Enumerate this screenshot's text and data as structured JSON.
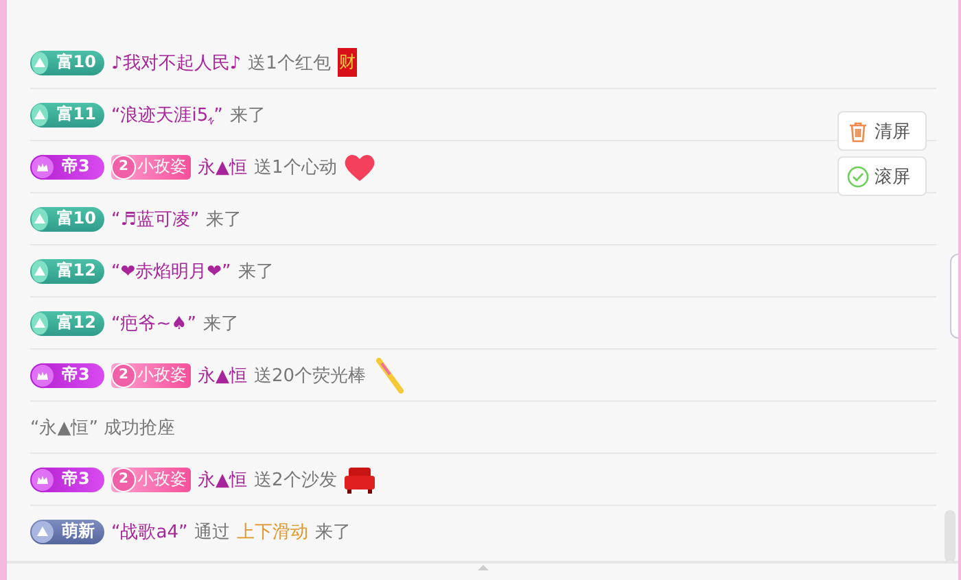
{
  "messages": [
    {
      "kind": "gift",
      "badge": {
        "kind": "fu",
        "label": "富10"
      },
      "name": "♪我对不起人民♪",
      "text": "送1个红包",
      "gift": {
        "kind": "envelope",
        "mark": "财"
      }
    },
    {
      "kind": "enter",
      "badge": {
        "kind": "fu",
        "label": "富11"
      },
      "name": "“浪迹天涯i5ﮩ”",
      "text": "来了"
    },
    {
      "kind": "gift",
      "badge": {
        "kind": "di",
        "label": "帝3"
      },
      "fan": {
        "number": "2",
        "label": "小孜姿"
      },
      "name": "永▲恒",
      "text": "送1个心动",
      "gift": {
        "kind": "heart"
      }
    },
    {
      "kind": "enter",
      "badge": {
        "kind": "fu",
        "label": "富10"
      },
      "name": "“♬蓝可凌”",
      "text": "来了"
    },
    {
      "kind": "enter",
      "badge": {
        "kind": "fu",
        "label": "富12"
      },
      "name": "“❤赤焰明月❤”",
      "text": "来了"
    },
    {
      "kind": "enter",
      "badge": {
        "kind": "fu",
        "label": "富12"
      },
      "name": "“疤爷~♠”",
      "text": "来了"
    },
    {
      "kind": "gift",
      "badge": {
        "kind": "di",
        "label": "帝3"
      },
      "fan": {
        "number": "2",
        "label": "小孜姿"
      },
      "name": "永▲恒",
      "text": "送20个荧光棒",
      "gift": {
        "kind": "glowstick"
      }
    },
    {
      "kind": "notice",
      "text": "“永▲恒” 成功抢座"
    },
    {
      "kind": "gift",
      "badge": {
        "kind": "di",
        "label": "帝3"
      },
      "fan": {
        "number": "2",
        "label": "小孜姿"
      },
      "name": "永▲恒",
      "text": "送2个沙发",
      "gift": {
        "kind": "sofa"
      }
    },
    {
      "kind": "enter_via",
      "badge": {
        "kind": "meng",
        "label": "萌新"
      },
      "name": "“战歌a4”",
      "via": "通过",
      "link": "上下滑动",
      "text": "来了"
    }
  ],
  "buttons": [
    {
      "kind": "clear",
      "label": "清屏"
    },
    {
      "kind": "scroll",
      "label": "滚屏"
    }
  ]
}
